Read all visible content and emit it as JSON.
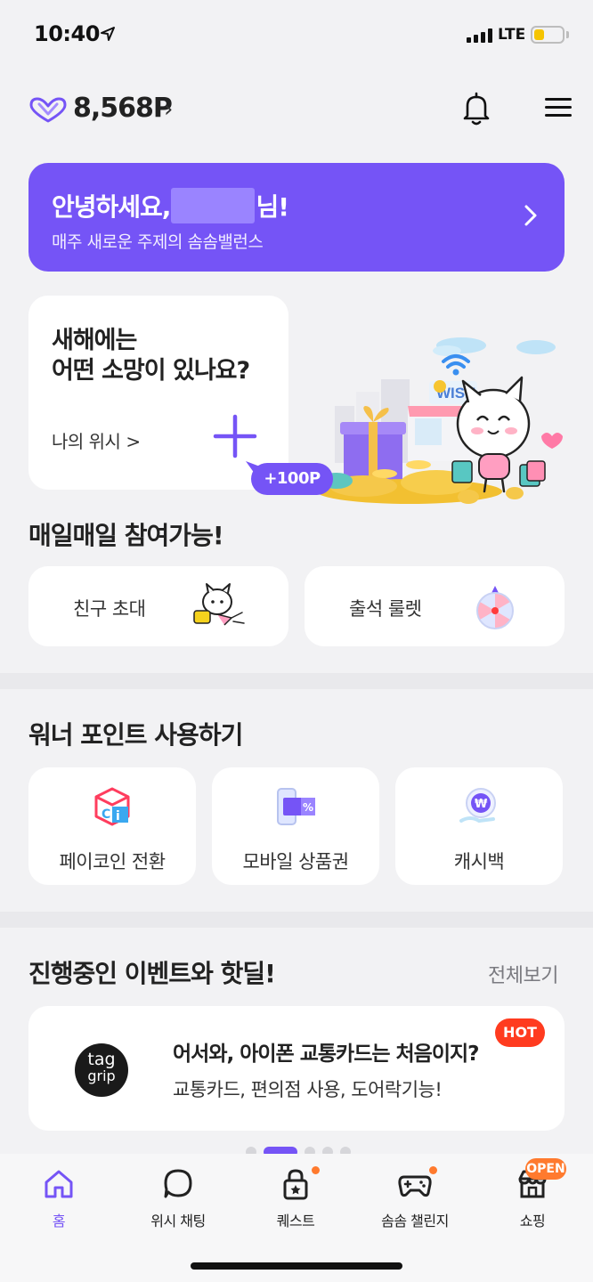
{
  "status_bar": {
    "time": "10:40",
    "network": "LTE",
    "battery_level": 0.35
  },
  "header": {
    "points": "8,568P",
    "points_chevron": "›"
  },
  "greeting": {
    "title_prefix": "안녕하세요,",
    "title_suffix": "님!",
    "subtitle": "매주 새로운 주제의 솜솜밸런스"
  },
  "wish": {
    "question_line1": "새해에는",
    "question_line2": "어떤 소망이 있나요?",
    "link": "나의 위시 >",
    "bonus": "+100P",
    "sign_text": "WISH"
  },
  "daily": {
    "title": "매일매일 참여가능!",
    "items": [
      {
        "label": "친구 초대"
      },
      {
        "label": "출석 룰렛"
      }
    ]
  },
  "use_points": {
    "title": "워너 포인트 사용하기",
    "items": [
      {
        "label": "페이코인 전환"
      },
      {
        "label": "모바일 상품권"
      },
      {
        "label": "캐시백"
      }
    ]
  },
  "events": {
    "title": "진행중인 이벤트와 핫딜!",
    "see_all": "전체보기",
    "card": {
      "logo_line1": "tag",
      "logo_line2": "grip",
      "headline": "어서와, 아이폰 교통카드는 처음이지?",
      "description": "교통카드, 편의점 사용, 도어락기능!",
      "badge": "HOT"
    },
    "page_count": 5,
    "active_page": 2
  },
  "tabbar": {
    "items": [
      {
        "label": "홈",
        "active": true
      },
      {
        "label": "위시 채팅"
      },
      {
        "label": "퀘스트"
      },
      {
        "label": "솜솜 챌린지"
      },
      {
        "label": "쇼핑"
      }
    ],
    "open_badge": "OPEN"
  },
  "colors": {
    "accent": "#7554f6",
    "hot": "#ff3b1f",
    "notify": "#ff7a2e",
    "background": "#f2f2f4"
  }
}
